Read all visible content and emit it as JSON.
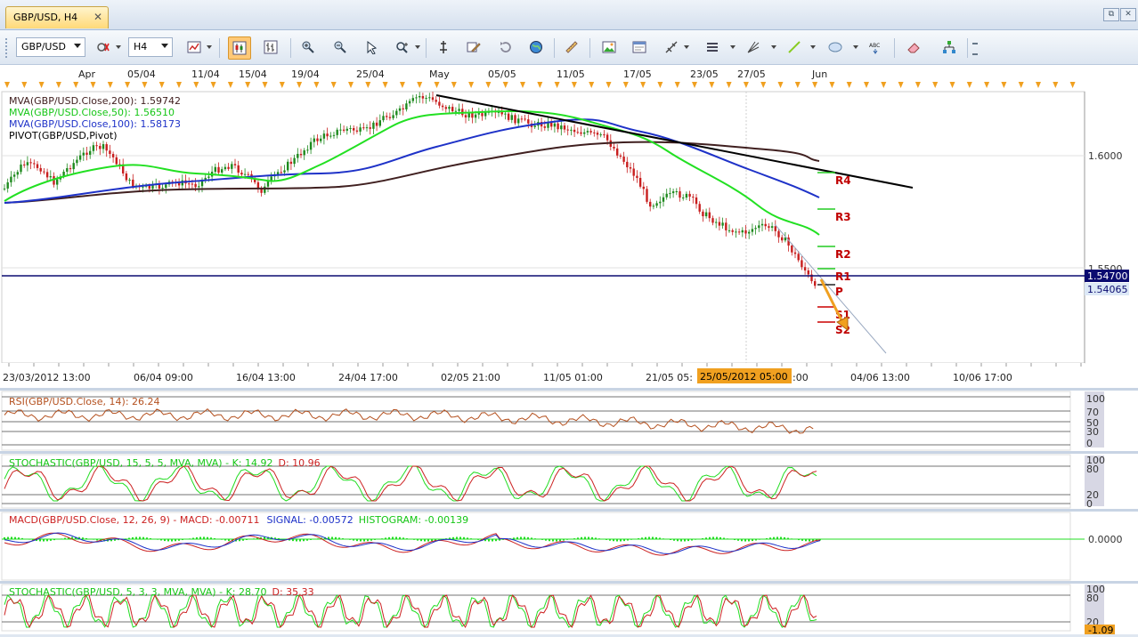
{
  "tab": {
    "label": "GBP/USD, H4",
    "close": "✕"
  },
  "window_controls": {
    "restore": "⧉",
    "close": "✕"
  },
  "toolbar": {
    "symbol": "GBP/USD",
    "timeframe": "H4",
    "buttons": [
      "chart-type",
      "candles-icon",
      "bars-icon",
      "zoom-in",
      "zoom-out",
      "cursor",
      "magnifier",
      "pin",
      "pencil",
      "refresh",
      "globe",
      "ruler",
      "picture",
      "template",
      "crosshair",
      "lines",
      "fan",
      "trendline",
      "ellipse",
      "text",
      "eraser",
      "hierarchy"
    ]
  },
  "top_axis": {
    "labels": [
      "Apr",
      "05/04",
      "11/04",
      "15/04",
      "19/04",
      "25/04",
      "May",
      "05/05",
      "11/05",
      "17/05",
      "23/05",
      "27/05",
      "Jun"
    ]
  },
  "legend": [
    {
      "text": "MVA(GBP/USD.Close,200): 1.59742",
      "color": "#402020"
    },
    {
      "text": "MVA(GBP/USD.Close,50): 1.56510",
      "color": "#16c616"
    },
    {
      "text": "MVA(GBP/USD.Close,100): 1.58173",
      "color": "#1e32c8"
    },
    {
      "text": "PIVOT(GBP/USD,Pivot)",
      "color": "#000000"
    }
  ],
  "price_axis": {
    "labels": [
      "1.6000",
      "1.5500"
    ],
    "current_line": "1.54700",
    "last_price": "1.54065"
  },
  "pivots": [
    "R4",
    "R3",
    "R2",
    "R1",
    "P",
    "S1",
    "S2"
  ],
  "time_axis": {
    "labels": [
      "23/03/2012 13:00",
      "06/04 09:00",
      "16/04 13:00",
      "24/04 17:00",
      "02/05 21:00",
      "11/05 01:00",
      "21/05 05:",
      "04/06 13:00",
      "10/06 17:00"
    ],
    "highlight": "25/05/2012 05:00",
    "after_highlight": ":00"
  },
  "rsi": {
    "legend": "RSI(GBP/USD.Close, 14): 26.24",
    "axis": [
      "100",
      "70",
      "50",
      "30",
      "0"
    ]
  },
  "stoch1": {
    "legend_a": "STOCHASTIC(GBP/USD, 15, 5, 5, MVA, MVA) -  ",
    "legend_k": "K: 14.92",
    "legend_d": "D: 10.96",
    "axis": [
      "100",
      "80",
      "20",
      "0"
    ]
  },
  "macd": {
    "legend_a": "MACD(GBP/USD.Close, 12, 26, 9) -  MACD: -0.00711",
    "legend_signal": "SIGNAL: -0.00572",
    "legend_hist": "HISTOGRAM: -0.00139",
    "axis": [
      "0.0000"
    ]
  },
  "stoch2": {
    "legend_a": "STOCHASTIC(GBP/USD, 5, 3, 3, MVA, MVA) -  ",
    "legend_k": "K: 28.70",
    "legend_d": "D: 35.33",
    "axis": [
      "100",
      "80",
      "20",
      "-1.09"
    ]
  },
  "colors": {
    "up": "#1e8a1e",
    "down": "#c81e1e",
    "ma50": "#16e016",
    "ma100": "#1e32c8",
    "ma200": "#402020",
    "pivot_label": "#c00000",
    "accent_orange": "#f0a020"
  }
}
